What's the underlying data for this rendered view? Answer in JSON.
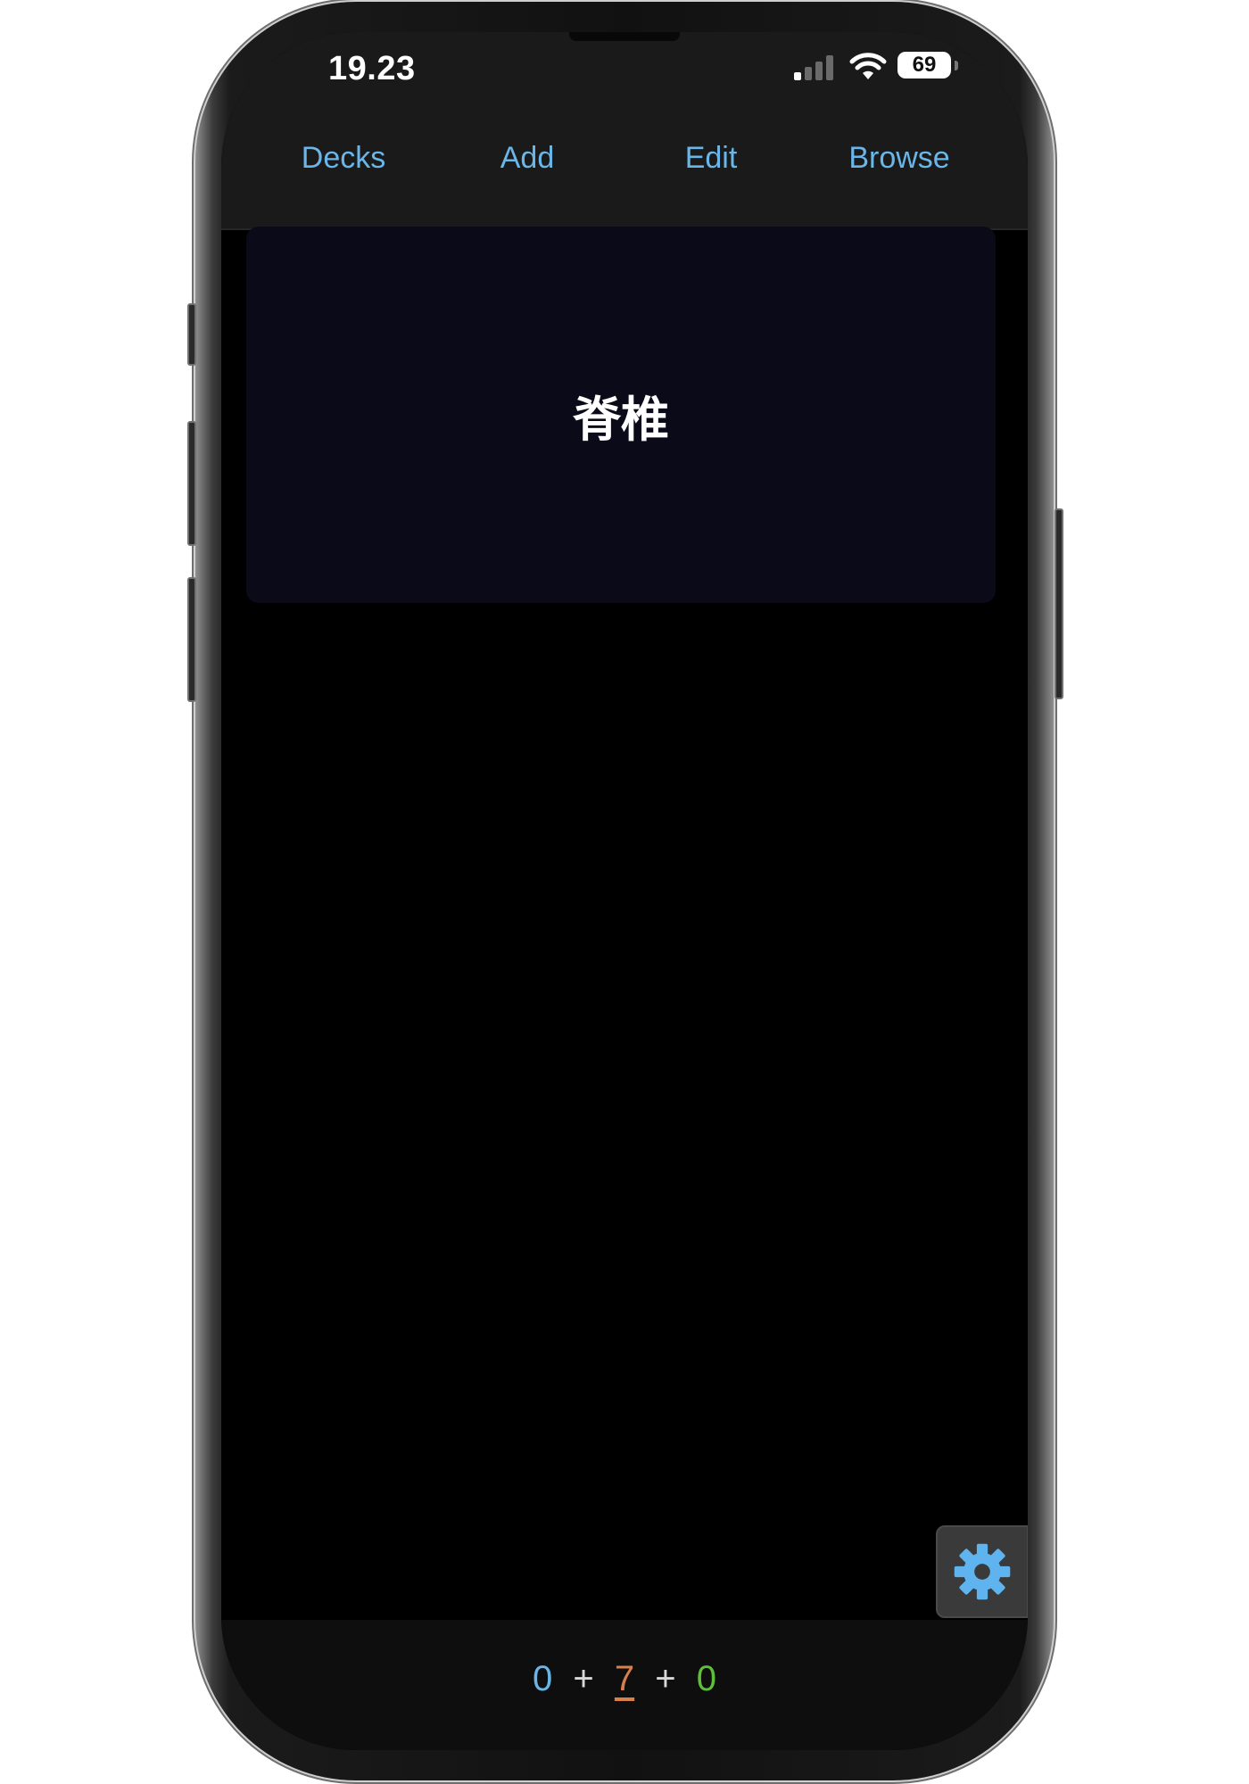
{
  "status_bar": {
    "time": "19.23",
    "battery": "69"
  },
  "nav": {
    "decks": "Decks",
    "add": "Add",
    "edit": "Edit",
    "browse": "Browse"
  },
  "card": {
    "front": "脊椎"
  },
  "counts": {
    "new": "0",
    "learning": "7",
    "review": "0",
    "separator": "+"
  },
  "colors": {
    "accent": "#6ab6e8",
    "learning": "#d8804a",
    "review": "#5fbf3a",
    "card_bg": "#0b0a18"
  },
  "icons": {
    "settings": "gear-icon",
    "signal": "cellular-signal-icon",
    "wifi": "wifi-icon",
    "battery": "battery-icon"
  }
}
